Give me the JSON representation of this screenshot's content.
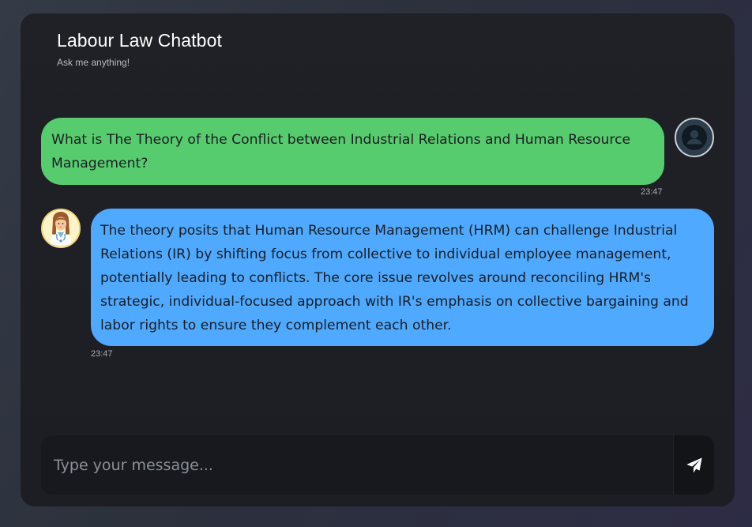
{
  "app": {
    "title": "Labour Law Chatbot",
    "subtitle": "Ask me anything!"
  },
  "messages": [
    {
      "role": "user",
      "text": "What is The Theory of the Conflict between Industrial Relations and Human Resource Management?",
      "time": "23:47",
      "avatar_icon": "user-icon"
    },
    {
      "role": "bot",
      "text": "The theory posits that Human Resource Management (HRM) can challenge Industrial Relations (IR) by shifting focus from collective to individual employee management, potentially leading to conflicts. The core issue revolves around reconciling HRM's strategic, individual-focused approach with IR's emphasis on collective bargaining and labor rights to ensure they complement each other.",
      "time": "23:47",
      "avatar_icon": "doctor-avatar-icon"
    }
  ],
  "composer": {
    "placeholder": "Type your message...",
    "value": "",
    "send_icon": "send-icon"
  },
  "colors": {
    "user_bubble": "#57cc6e",
    "bot_bubble": "#4ea9ff",
    "card_bg": "#1f2127"
  }
}
